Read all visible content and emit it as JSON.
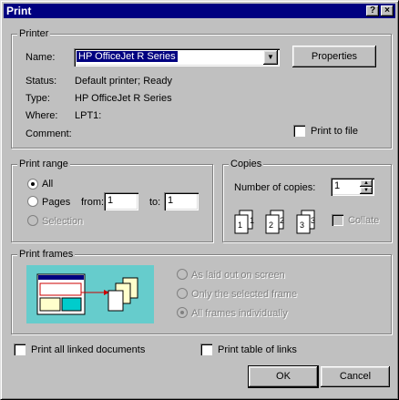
{
  "window": {
    "title": "Print",
    "help": "?",
    "close": "×"
  },
  "printer": {
    "group_label": "Printer",
    "name_label": "Name:",
    "name_value": "HP OfficeJet R Series",
    "properties_label": "Properties",
    "status_label": "Status:",
    "status_value": "Default printer; Ready",
    "type_label": "Type:",
    "type_value": "HP OfficeJet R Series",
    "where_label": "Where:",
    "where_value": "LPT1:",
    "comment_label": "Comment:",
    "print_to_file_label": "Print to file",
    "print_to_file_checked": false
  },
  "print_range": {
    "group_label": "Print range",
    "all_label": "All",
    "pages_label": "Pages",
    "from_label": "from:",
    "from_value": "1",
    "to_label": "to:",
    "to_value": "1",
    "selection_label": "Selection",
    "selected": "All"
  },
  "copies": {
    "group_label": "Copies",
    "number_label": "Number of copies:",
    "number_value": "1",
    "collate_label": "Collate",
    "collate_checked": false
  },
  "print_frames": {
    "group_label": "Print frames",
    "option_layout": "As laid out on screen",
    "option_selected": "Only the selected frame",
    "option_individually": "All frames individually",
    "selected": "All frames individually"
  },
  "options": {
    "linked_docs_label": "Print all linked documents",
    "table_of_links_label": "Print table of links"
  },
  "buttons": {
    "ok": "OK",
    "cancel": "Cancel"
  }
}
